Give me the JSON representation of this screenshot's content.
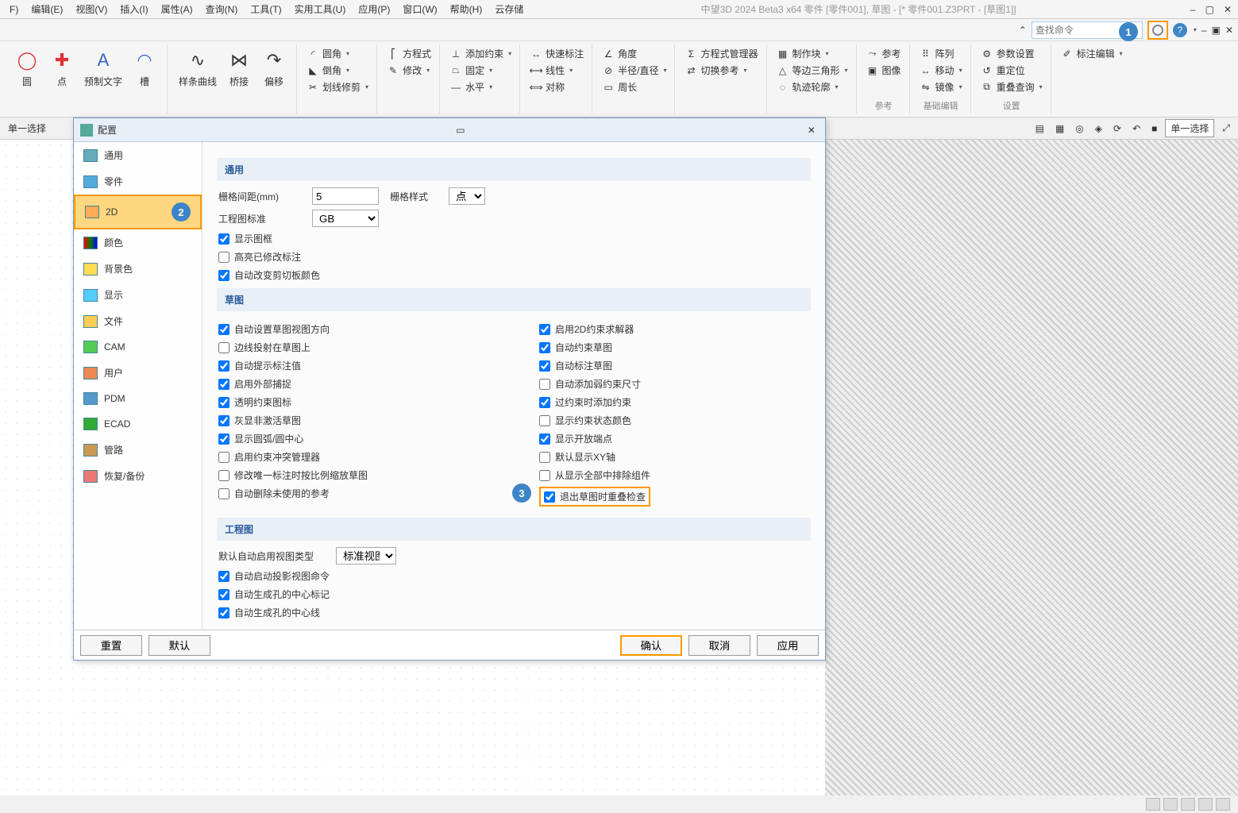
{
  "app": {
    "title": "中望3D 2024 Beta3 x64     零件 [零件001], 草图 - [* 零件001.Z3PRT - [草图1]]"
  },
  "menu": [
    "F)",
    "编辑(E)",
    "视图(V)",
    "插入(I)",
    "属性(A)",
    "查询(N)",
    "工具(T)",
    "实用工具(U)",
    "应用(P)",
    "窗口(W)",
    "帮助(H)",
    "云存储"
  ],
  "search": {
    "placeholder": "查找命令"
  },
  "callouts": {
    "c1": "1",
    "c2": "2",
    "c3": "3"
  },
  "ribbon": {
    "big": [
      {
        "icon": "◯",
        "label": "圆"
      },
      {
        "icon": "✚",
        "label": "点"
      },
      {
        "icon": "A",
        "label": "预制文字"
      },
      {
        "icon": "◠",
        "label": "槽"
      },
      {
        "icon": "∿",
        "label": "样条曲线"
      },
      {
        "icon": "⋈",
        "label": "桥接"
      },
      {
        "icon": "↷",
        "label": "偏移"
      }
    ],
    "g1": [
      "圆角",
      "倒角",
      "划线修剪"
    ],
    "g2": [
      "方程式",
      "修改"
    ],
    "g3": [
      "添加约束",
      "固定",
      "水平"
    ],
    "g4": [
      "快速标注",
      "线性",
      "对称"
    ],
    "g5": [
      "角度",
      "半径/直径",
      "周长"
    ],
    "g6": [
      "方程式管理器",
      "切换参考"
    ],
    "g7": [
      "制作块",
      "等边三角形",
      "轨迹轮廓"
    ],
    "g8": [
      "参考",
      "图像"
    ],
    "g9": [
      "阵列",
      "移动",
      "镜像"
    ],
    "g10": [
      "参数设置",
      "重定位",
      "重叠查询"
    ],
    "g11": [
      "标注编辑"
    ],
    "labels": {
      "ref": "参考",
      "edit": "基础编辑",
      "set": "设置"
    }
  },
  "secondary": {
    "left": "单一选择",
    "mode": "单一选择"
  },
  "dialog": {
    "title": "配置",
    "nav": [
      "通用",
      "零件",
      "2D",
      "颜色",
      "背景色",
      "显示",
      "文件",
      "CAM",
      "用户",
      "PDM",
      "ECAD",
      "管路",
      "恢复/备份"
    ],
    "sections": {
      "s1": "通用",
      "s2": "草图",
      "s3": "工程图"
    },
    "labels": {
      "grid_spacing": "栅格间距(mm)",
      "grid_style": "栅格样式",
      "draw_std": "工程图标准",
      "default_view_type": "默认自动启用视图类型"
    },
    "values": {
      "grid_spacing": "5",
      "grid_style": "点",
      "draw_std": "GB",
      "default_view_type": "标准视图"
    },
    "checks": {
      "show_frame": "显示图框",
      "highlight_mod": "高亮已修改标注",
      "auto_clip_color": "自动改变剪切板颜色",
      "auto_sketch_dir": "自动设置草图视图方向",
      "edge_proj": "边线投射在草图上",
      "auto_hint": "自动提示标注值",
      "ext_snap": "启用外部捕捉",
      "trans_icon": "透明约束图标",
      "gray_inactive": "灰显非激活草图",
      "show_arc": "显示圆弧/圆中心",
      "conflict_mgr": "启用约束冲突管理器",
      "mod_unique_scale": "修改唯一标注时按比例缩放草图",
      "auto_del_unused": "自动删除未使用的参考",
      "enable_2d_solver": "启用2D约束求解器",
      "auto_constrain": "自动约束草图",
      "auto_dim": "自动标注草图",
      "auto_weak": "自动添加弱约束尺寸",
      "over_add": "过约束时添加约束",
      "show_state_color": "显示约束状态颜色",
      "show_open_end": "显示开放端点",
      "default_xy": "默认显示XY轴",
      "exclude_showall": "从显示全部中排除组件",
      "exit_overlap": "退出草图时重叠检查",
      "auto_proj_cmd": "自动启动投影视图命令",
      "auto_hole_mark": "自动生成孔的中心标记",
      "auto_hole_line": "自动生成孔的中心线"
    },
    "checked": {
      "show_frame": true,
      "highlight_mod": false,
      "auto_clip_color": true,
      "auto_sketch_dir": true,
      "edge_proj": false,
      "auto_hint": true,
      "ext_snap": true,
      "trans_icon": true,
      "gray_inactive": true,
      "show_arc": true,
      "conflict_mgr": false,
      "mod_unique_scale": false,
      "auto_del_unused": false,
      "enable_2d_solver": true,
      "auto_constrain": true,
      "auto_dim": true,
      "auto_weak": false,
      "over_add": true,
      "show_state_color": false,
      "show_open_end": true,
      "default_xy": false,
      "exclude_showall": false,
      "exit_overlap": true,
      "auto_proj_cmd": true,
      "auto_hole_mark": true,
      "auto_hole_line": true
    },
    "buttons": {
      "reset": "重置",
      "default": "默认",
      "ok": "确认",
      "cancel": "取消",
      "apply": "应用"
    }
  }
}
